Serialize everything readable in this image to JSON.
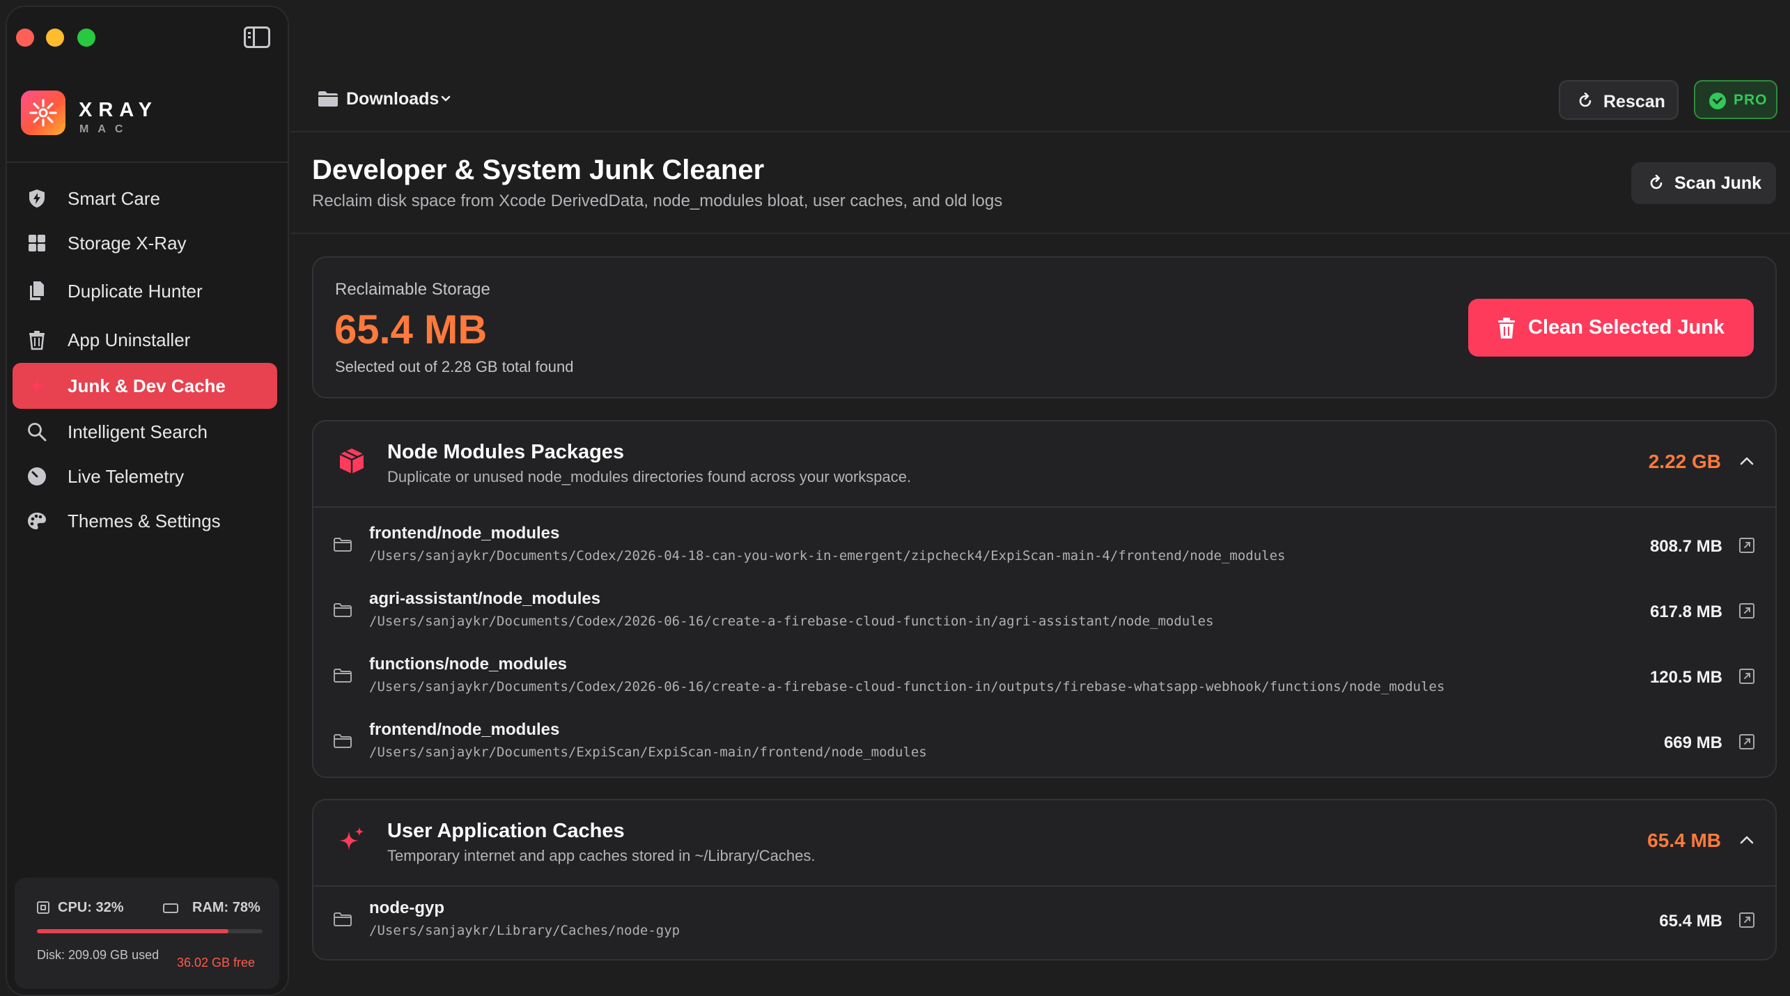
{
  "window": {
    "title": "XRAY MAC"
  },
  "brand": {
    "name": "XRAY",
    "sub": "MAC"
  },
  "sidebar": {
    "items": [
      {
        "label": "Smart Care",
        "icon": "shield-bolt-icon"
      },
      {
        "label": "Storage X-Ray",
        "icon": "grid-icon"
      },
      {
        "label": "Duplicate Hunter",
        "icon": "duplicate-docs-icon"
      },
      {
        "label": "App Uninstaller",
        "icon": "trash-icon"
      },
      {
        "label": "Junk & Dev Cache",
        "icon": "sparkle-icon",
        "active": true
      },
      {
        "label": "Intelligent Search",
        "icon": "search-icon"
      },
      {
        "label": "Live Telemetry",
        "icon": "gauge-icon"
      },
      {
        "label": "Themes & Settings",
        "icon": "palette-icon"
      }
    ],
    "system": {
      "cpu": "CPU: 32%",
      "ram": "RAM: 78%",
      "usage_fraction": 0.85,
      "disk_used": "Disk: 209.09 GB used",
      "disk_free": "36.02 GB free"
    }
  },
  "toolbar": {
    "location": "Downloads",
    "rescan_label": "Rescan",
    "pro_label": "PRO"
  },
  "header": {
    "title": "Developer & System Junk Cleaner",
    "subtitle": "Reclaim disk space from Xcode DerivedData, node_modules bloat, user caches, and old logs",
    "scan_label": "Scan Junk"
  },
  "summary": {
    "label": "Reclaimable Storage",
    "value": "65.4 MB",
    "sub": "Selected out of 2.28 GB total found",
    "clean_label": "Clean Selected Junk"
  },
  "groups": [
    {
      "title": "Node Modules Packages",
      "description": "Duplicate or unused node_modules directories found across your workspace.",
      "size": "2.22 GB",
      "items": [
        {
          "name": "frontend/node_modules",
          "path": "/Users/sanjaykr/Documents/Codex/2026-04-18-can-you-work-in-emergent/zipcheck4/ExpiScan-main-4/frontend/node_modules",
          "size": "808.7 MB"
        },
        {
          "name": "agri-assistant/node_modules",
          "path": "/Users/sanjaykr/Documents/Codex/2026-06-16/create-a-firebase-cloud-function-in/agri-assistant/node_modules",
          "size": "617.8 MB"
        },
        {
          "name": "functions/node_modules",
          "path": "/Users/sanjaykr/Documents/Codex/2026-06-16/create-a-firebase-cloud-function-in/outputs/firebase-whatsapp-webhook/functions/node_modules",
          "size": "120.5 MB"
        },
        {
          "name": "frontend/node_modules",
          "path": "/Users/sanjaykr/Documents/ExpiScan/ExpiScan-main/frontend/node_modules",
          "size": "669 MB"
        }
      ]
    },
    {
      "title": "User Application Caches",
      "description": "Temporary internet and app caches stored in ~/Library/Caches.",
      "size": "65.4 MB",
      "items": [
        {
          "name": "node-gyp",
          "path": "/Users/sanjaykr/Library/Caches/node-gyp",
          "size": "65.4 MB"
        }
      ]
    }
  ],
  "colors": {
    "accent": "#e8414f",
    "clean_button": "#ff3b5c",
    "size_orange": "#ff7a3c",
    "pro_green": "#34c759"
  }
}
